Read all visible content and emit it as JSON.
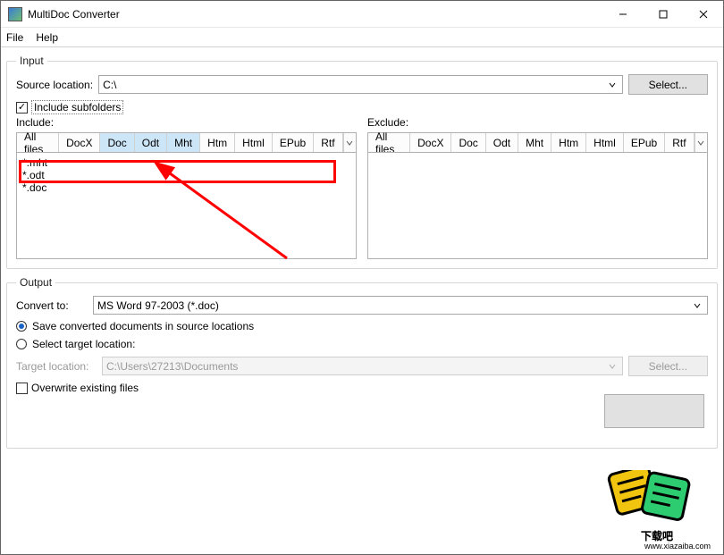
{
  "window": {
    "title": "MultiDoc Converter"
  },
  "menu": {
    "file": "File",
    "help": "Help"
  },
  "input": {
    "legend": "Input",
    "source_label": "Source location:",
    "source_value": "C:\\",
    "select_btn": "Select...",
    "include_subfolders": "Include subfolders",
    "include_label": "Include:",
    "exclude_label": "Exclude:",
    "tabs": [
      "All files",
      "DocX",
      "Doc",
      "Odt",
      "Mht",
      "Htm",
      "Html",
      "EPub",
      "Rtf"
    ],
    "include_list": "*.mht\n*.odt\n*.doc"
  },
  "output": {
    "legend": "Output",
    "convert_to_label": "Convert to:",
    "convert_to_value": "MS Word 97-2003 (*.doc)",
    "radio_source": "Save converted documents in source locations",
    "radio_target": "Select target location:",
    "target_label": "Target location:",
    "target_value": "C:\\Users\\27213\\Documents",
    "select_btn": "Select...",
    "overwrite": "Overwrite existing files"
  },
  "watermark": "www.xiazaiba.com"
}
